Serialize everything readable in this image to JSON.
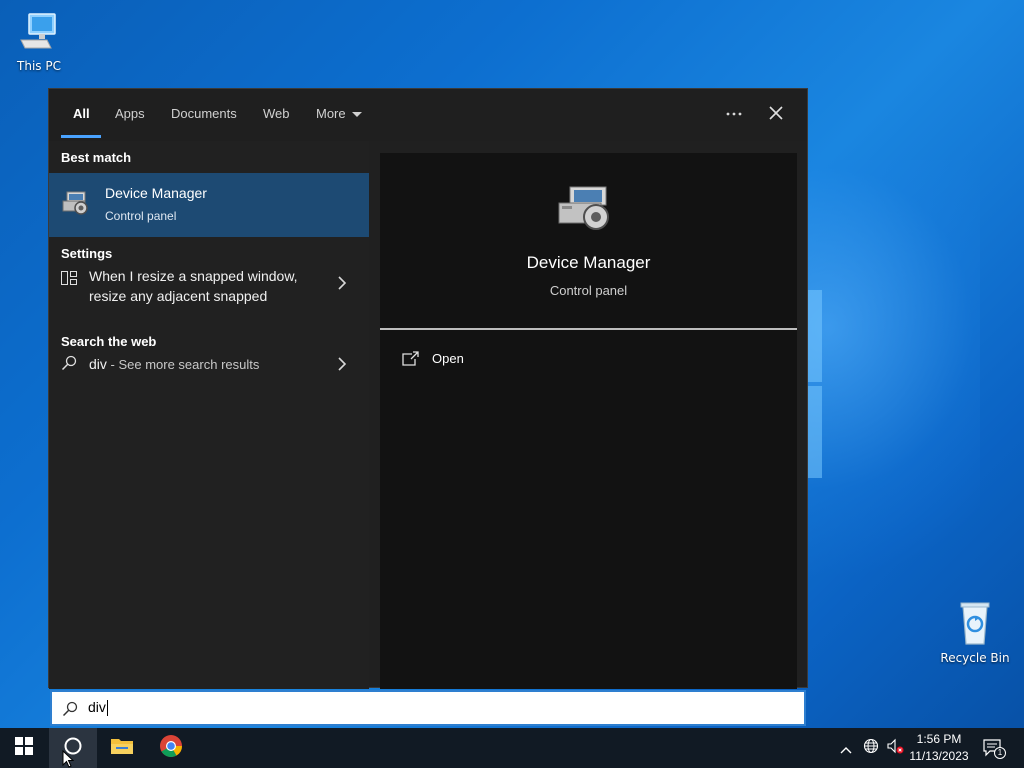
{
  "desktop": {
    "icons": [
      {
        "label": "This PC",
        "icon": "this-pc-icon"
      },
      {
        "label": "Recycle Bin",
        "icon": "recycle-bin-icon"
      }
    ]
  },
  "search_panel": {
    "tabs": [
      {
        "label": "All",
        "active": true
      },
      {
        "label": "Apps"
      },
      {
        "label": "Documents"
      },
      {
        "label": "Web"
      },
      {
        "label": "More",
        "has_dropdown": true
      }
    ],
    "more_options_icon": "ellipsis-icon",
    "close_icon": "close-icon",
    "sections": {
      "best_match": {
        "header": "Best match",
        "item": {
          "title": "Device Manager",
          "subtitle": "Control panel",
          "icon": "device-manager-icon"
        }
      },
      "settings": {
        "header": "Settings",
        "item": {
          "line1": "When I resize a snapped window,",
          "line2": "resize any adjacent snapped",
          "icon": "snap-window-icon"
        }
      },
      "web": {
        "header": "Search the web",
        "item": {
          "query": "div",
          "suffix": " - See more search results",
          "icon": "search-icon"
        }
      }
    },
    "detail": {
      "title": "Device Manager",
      "subtitle": "Control panel",
      "actions": [
        {
          "label": "Open",
          "icon": "open-icon"
        }
      ]
    }
  },
  "search_box": {
    "value": "div",
    "icon": "search-icon"
  },
  "taskbar": {
    "buttons": [
      {
        "name": "start",
        "icon": "windows-logo-icon"
      },
      {
        "name": "search",
        "icon": "cortana-circle-icon",
        "active": true
      },
      {
        "name": "file-explorer",
        "icon": "folder-icon"
      },
      {
        "name": "chrome",
        "icon": "chrome-icon"
      }
    ],
    "tray": {
      "chevron_icon": "chevron-up-icon",
      "network_icon": "globe-icon",
      "volume_icon": "volume-muted-icon",
      "time": "1:56 PM",
      "date": "11/13/2023",
      "notification_count": "1"
    }
  },
  "colors": {
    "accent": "#4aa3ff",
    "selection": "#1d4a73",
    "panel": "#202020",
    "detail_bg": "#121212",
    "taskbar": "#111a24"
  }
}
